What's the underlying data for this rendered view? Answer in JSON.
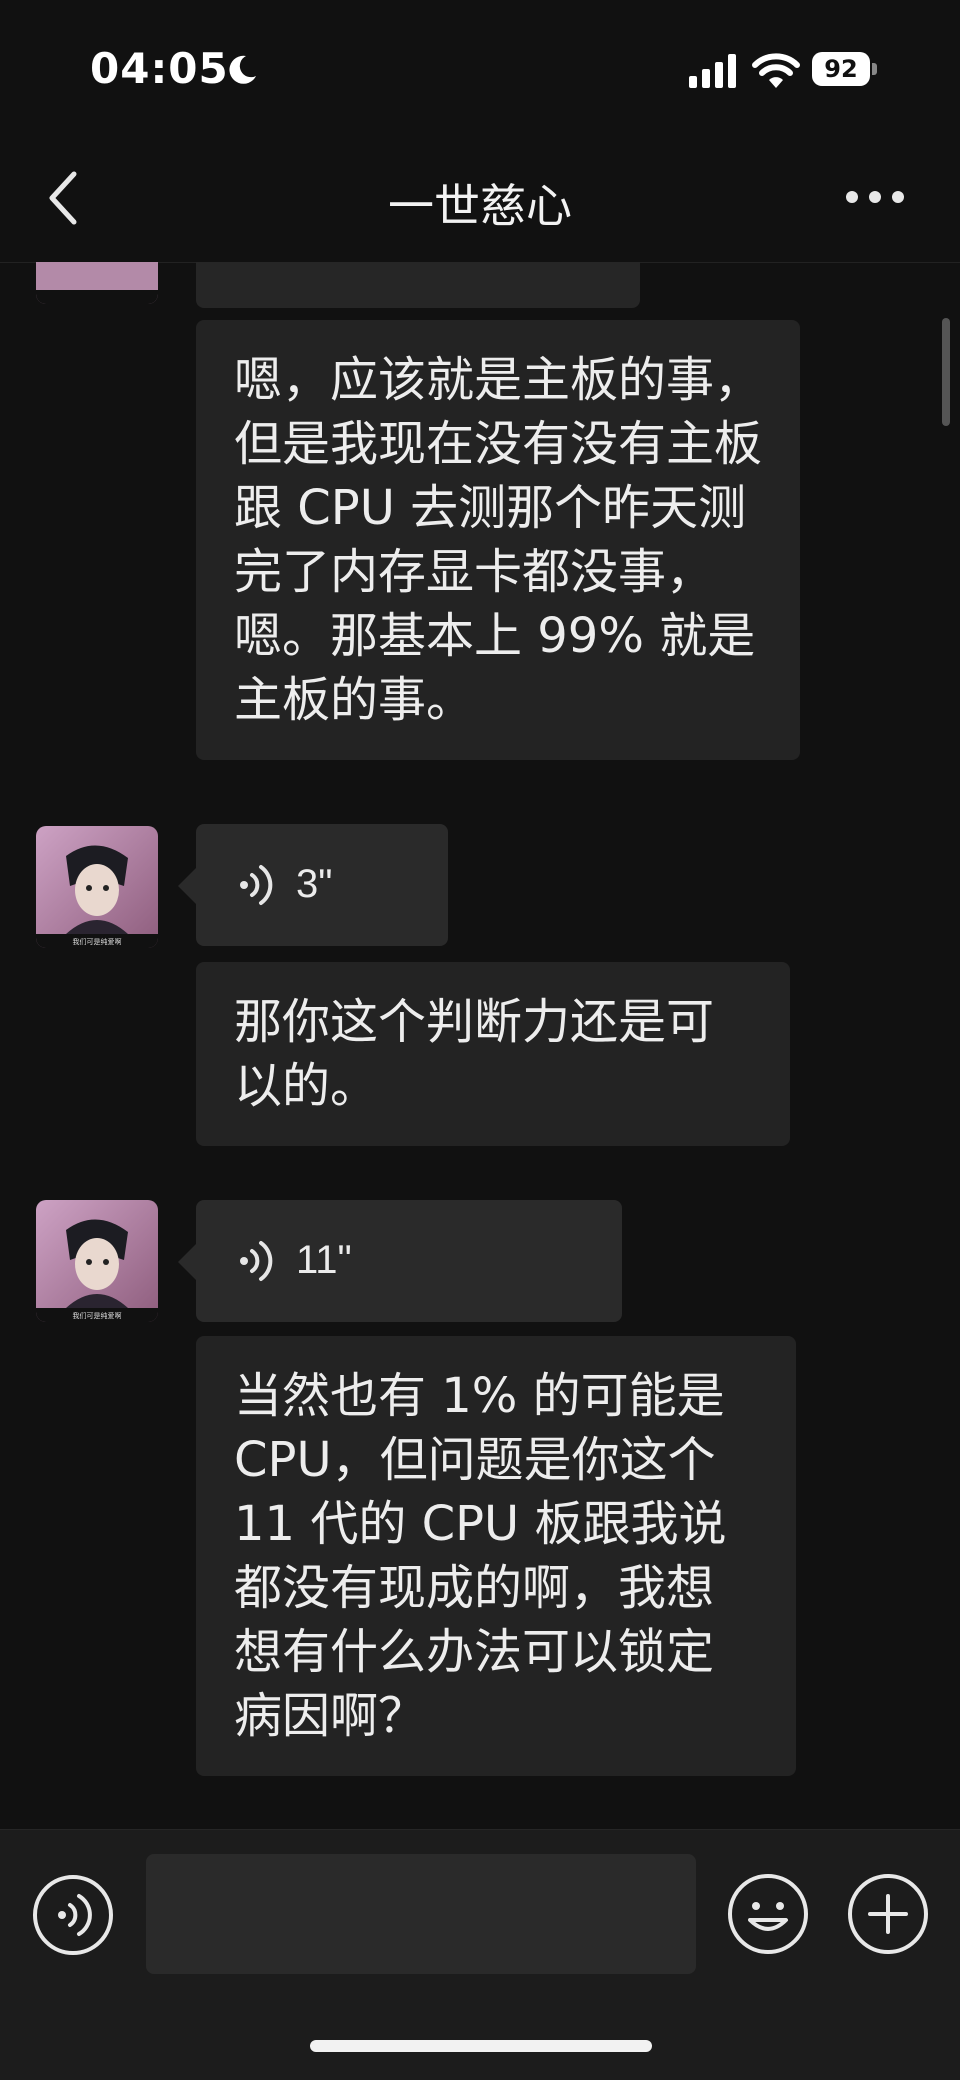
{
  "status_bar": {
    "time": "04:05",
    "battery_level": "92",
    "icons": [
      "moon-icon",
      "signal-icon",
      "wifi-icon",
      "battery-icon"
    ]
  },
  "nav": {
    "title": "一世慈心",
    "back_icon": "chevron-left-icon",
    "more_icon": "more-dots-icon"
  },
  "messages": [
    {
      "type": "text",
      "text": "嗯，应该就是主板的事，但是我现在没有没有主板跟 CPU 去测那个昨天测完了内存显卡都没事，嗯。那基本上 99% 就是主板的事。"
    },
    {
      "type": "voice",
      "duration": "3\""
    },
    {
      "type": "text",
      "text": "那你这个判断力还是可以的。"
    },
    {
      "type": "voice",
      "duration": "11\""
    },
    {
      "type": "text",
      "text": "当然也有 1% 的可能是 CPU，但问题是你这个 11 代的 CPU 板跟我说都没有现成的啊，我想想有什么办法可以锁定病因啊？"
    }
  ],
  "avatar_caption": "我们可是纯爱啊",
  "input_bar": {
    "placeholder": "",
    "icons": [
      "voice-toggle-icon",
      "emoji-icon",
      "plus-icon"
    ]
  },
  "colors": {
    "background": "#111111",
    "bubble": "#232323",
    "text": "#ececec"
  }
}
